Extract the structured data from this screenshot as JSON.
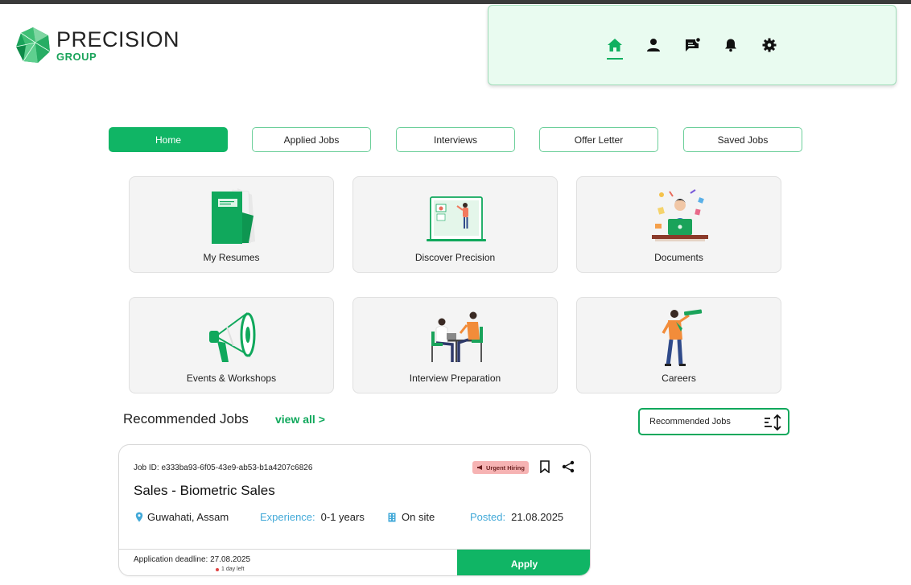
{
  "brand": {
    "name": "PRECISION",
    "sub": "GROUP"
  },
  "nav_icons": [
    "home-icon",
    "profile-icon",
    "messages-icon",
    "bell-icon",
    "gear-icon"
  ],
  "tabs": [
    {
      "label": "Home",
      "active": true
    },
    {
      "label": "Applied Jobs"
    },
    {
      "label": "Interviews"
    },
    {
      "label": "Offer Letter"
    },
    {
      "label": "Saved Jobs"
    }
  ],
  "cards": [
    {
      "label": "My Resumes"
    },
    {
      "label": "Discover Precision"
    },
    {
      "label": "Documents"
    },
    {
      "label": "Events & Workshops"
    },
    {
      "label": "Interview Preparation"
    },
    {
      "label": "Careers"
    }
  ],
  "recommended": {
    "title": "Recommended Jobs",
    "view_all": "view all >",
    "sort_label": "Recommended Jobs"
  },
  "job": {
    "id_text": "Job ID: e333ba93-6f05-43e9-ab53-b1a4207c6826",
    "badge": "Urgent Hiring",
    "title": "Sales - Biometric Sales",
    "location": "Guwahati, Assam",
    "experience_label": "Experience:",
    "experience_value": "0-1 years",
    "work_mode": "On site",
    "posted_label": "Posted:",
    "posted_value": "21.08.2025",
    "deadline": "Application deadline: 27.08.2025",
    "days_left": "1 day left",
    "apply_label": "Apply"
  },
  "colors": {
    "accent": "#10b565",
    "panel": "#e9fbf0",
    "link_blue": "#42a9d8",
    "badge": "#f6b3b3"
  }
}
